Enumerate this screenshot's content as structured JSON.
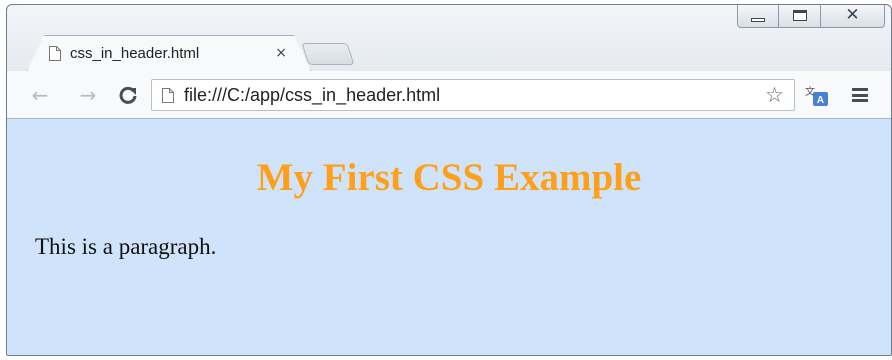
{
  "browser": {
    "tab": {
      "title": "css_in_header.html",
      "close_label": "×"
    },
    "address_bar": {
      "url": "file:///C:/app/css_in_header.html"
    },
    "icons": {
      "back": "back-arrow-icon",
      "forward": "forward-arrow-icon",
      "reload": "reload-icon",
      "bookmark": "star-icon",
      "translate": "translate-icon",
      "menu": "hamburger-menu-icon"
    }
  },
  "page": {
    "heading": "My First CSS Example",
    "paragraph": "This is a paragraph.",
    "background_color": "#cfe3fb",
    "heading_color": "#ff9f1a"
  }
}
